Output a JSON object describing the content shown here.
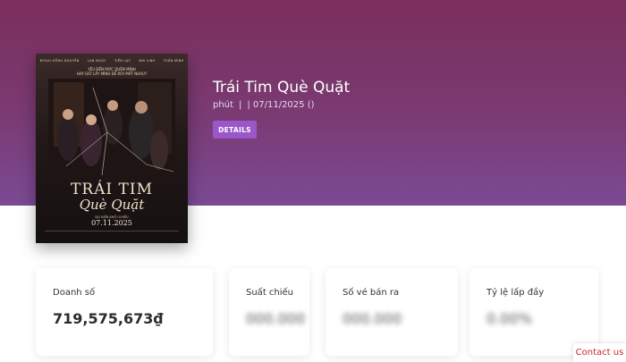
{
  "movie": {
    "title": "Trái Tim Què Quặt",
    "meta_duration": "phút",
    "meta_divider": "|",
    "meta_release": "| 07/11/2025 ()",
    "details_label": "DETAILS"
  },
  "poster": {
    "cast_names": [
      "KHOAI HỒNG NGUYỄN",
      "LAN NGỌC",
      "TIẾN LẠC",
      "NHI LINH",
      "TUẤN MINH"
    ],
    "tagline_line1": "YÊU ĐẾN MỨC QUÊN MÌNH",
    "tagline_line2": "HAY GIỮ LẤY MÌNH ĐỂ RỜI MẤT NHAU?",
    "title_line1": "TRÁI TIM",
    "title_line2": "Què Quặt",
    "release_label": "DỰ KIẾN KHỞI CHIẾU",
    "release_date": "07.11.2025"
  },
  "stats": [
    {
      "label": "Doanh số",
      "value": "719,575,673₫",
      "blurred": false
    },
    {
      "label": "Suất chiếu",
      "value": "000.000",
      "blurred": true
    },
    {
      "label": "Số vé bán ra",
      "value": "000.000",
      "blurred": true
    },
    {
      "label": "Tỷ lệ lấp đầy",
      "value": "0.00%",
      "blurred": true
    }
  ],
  "contact_label": "Contact us",
  "colors": {
    "hero_top": "#7b2f5c",
    "hero_bottom": "#7a4a94",
    "details_button": "#9b57c9",
    "contact_text": "#c62828"
  }
}
